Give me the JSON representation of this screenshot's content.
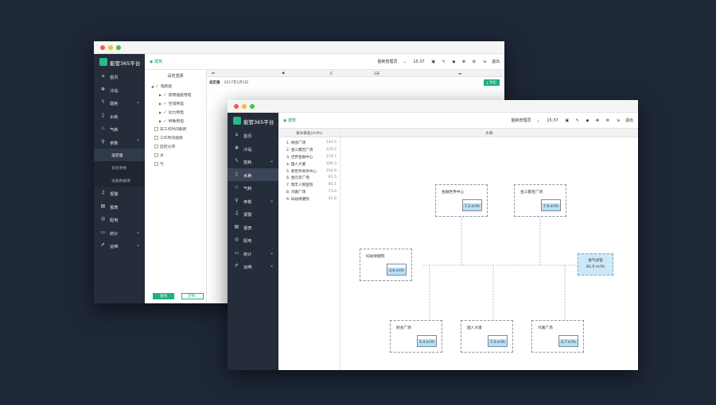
{
  "app": {
    "logo_text": "能管365平台",
    "location": "建筑",
    "user": "能耗管理员",
    "time": "15:37",
    "logout": "退出"
  },
  "window1": {
    "sidebar": [
      {
        "label": "首页",
        "icon": "home-icon"
      },
      {
        "label": "冷站",
        "icon": "snowflake-icon"
      },
      {
        "label": "能耗",
        "icon": "bolt-icon",
        "chevron": true
      },
      {
        "label": "水耗",
        "icon": "drop-icon"
      },
      {
        "label": "气耗",
        "icon": "flame-icon"
      },
      {
        "label": "参数",
        "icon": "search-icon",
        "chevron": true
      }
    ],
    "sidebar_sub": [
      "设定值",
      "系统参数",
      "设备数据库"
    ],
    "sidebar_bottom": [
      {
        "label": "报警",
        "icon": "bell-icon"
      },
      {
        "label": "报表",
        "icon": "report-icon"
      },
      {
        "label": "配电",
        "icon": "eye-icon"
      },
      {
        "label": "统计",
        "icon": "monitor-icon",
        "chevron": true
      },
      {
        "label": "运维",
        "icon": "wrench-icon",
        "chevron": true
      }
    ],
    "tree": {
      "header": "设定选择",
      "nodes": [
        {
          "label": "电耗能",
          "type": "root"
        },
        {
          "label": "照明插座用电",
          "type": "checked"
        },
        {
          "label": "空调用电",
          "type": "checked"
        },
        {
          "label": "动力用电",
          "type": "checked"
        },
        {
          "label": "特殊用电",
          "type": "checked"
        },
        {
          "label": "非工作时间能耗",
          "type": "box"
        },
        {
          "label": "工作时间能耗",
          "type": "box"
        },
        {
          "label": "监控分项",
          "type": "box"
        },
        {
          "label": "水",
          "type": "box"
        },
        {
          "label": "气",
          "type": "box"
        }
      ],
      "btn_query": "查询",
      "btn_define": "定制"
    },
    "timebar": [
      "天",
      "3天"
    ],
    "subbar": {
      "bold": "设定值",
      "text": "2017年1月1日"
    },
    "export_label": "导出"
  },
  "window2": {
    "sidebar": [
      {
        "label": "首页",
        "icon": "home-icon"
      },
      {
        "label": "冷站",
        "icon": "snowflake-icon"
      },
      {
        "label": "能耗",
        "icon": "bolt-icon",
        "chevron": true
      },
      {
        "label": "水耗",
        "icon": "drop-icon",
        "active": true
      },
      {
        "label": "气耗",
        "icon": "flame-icon"
      },
      {
        "label": "参数",
        "icon": "search-icon",
        "chevron": true
      },
      {
        "label": "报警",
        "icon": "bell-icon"
      },
      {
        "label": "报表",
        "icon": "report-icon"
      },
      {
        "label": "配电",
        "icon": "eye-icon"
      },
      {
        "label": "统计",
        "icon": "monitor-icon",
        "chevron": true
      },
      {
        "label": "运维",
        "icon": "wrench-icon",
        "chevron": true
      }
    ],
    "rank": {
      "header": "排水排名(m³/h)",
      "rows": [
        {
          "label": "1. 财会广场",
          "value": "144.5"
        },
        {
          "label": "2. 金三都百广场",
          "value": "129.2"
        },
        {
          "label": "3. 世界金融中心",
          "value": "119.7"
        },
        {
          "label": "4. 国人大厦",
          "value": "109.3"
        },
        {
          "label": "5. 新世界商务中心",
          "value": "104.9"
        },
        {
          "label": "6. 金元华广场",
          "value": "91.5"
        },
        {
          "label": "7. 瑞丰人民医院",
          "value": "85.1"
        },
        {
          "label": "8. 鸿嘉广场",
          "value": "73.6"
        },
        {
          "label": "9. 妇幼保健院",
          "value": "42.8"
        }
      ]
    },
    "diagram_header": "水耗",
    "nodes": [
      {
        "label": "金融世界中心",
        "value": "7.2 m³/h"
      },
      {
        "label": "金三都百广场",
        "value": "7.9 m³/h"
      },
      {
        "label": "妇幼保健院",
        "value": "3.6 m³/h"
      },
      {
        "label": "财会广场",
        "value": "5.4 m³/h"
      },
      {
        "label": "国人大厦",
        "value": "7.4 m³/h"
      },
      {
        "label": "鸿嘉广场",
        "value": "4.7 m³/h"
      }
    ],
    "main_node": {
      "label": "进气总管",
      "value": "81.0 m³/h"
    }
  }
}
